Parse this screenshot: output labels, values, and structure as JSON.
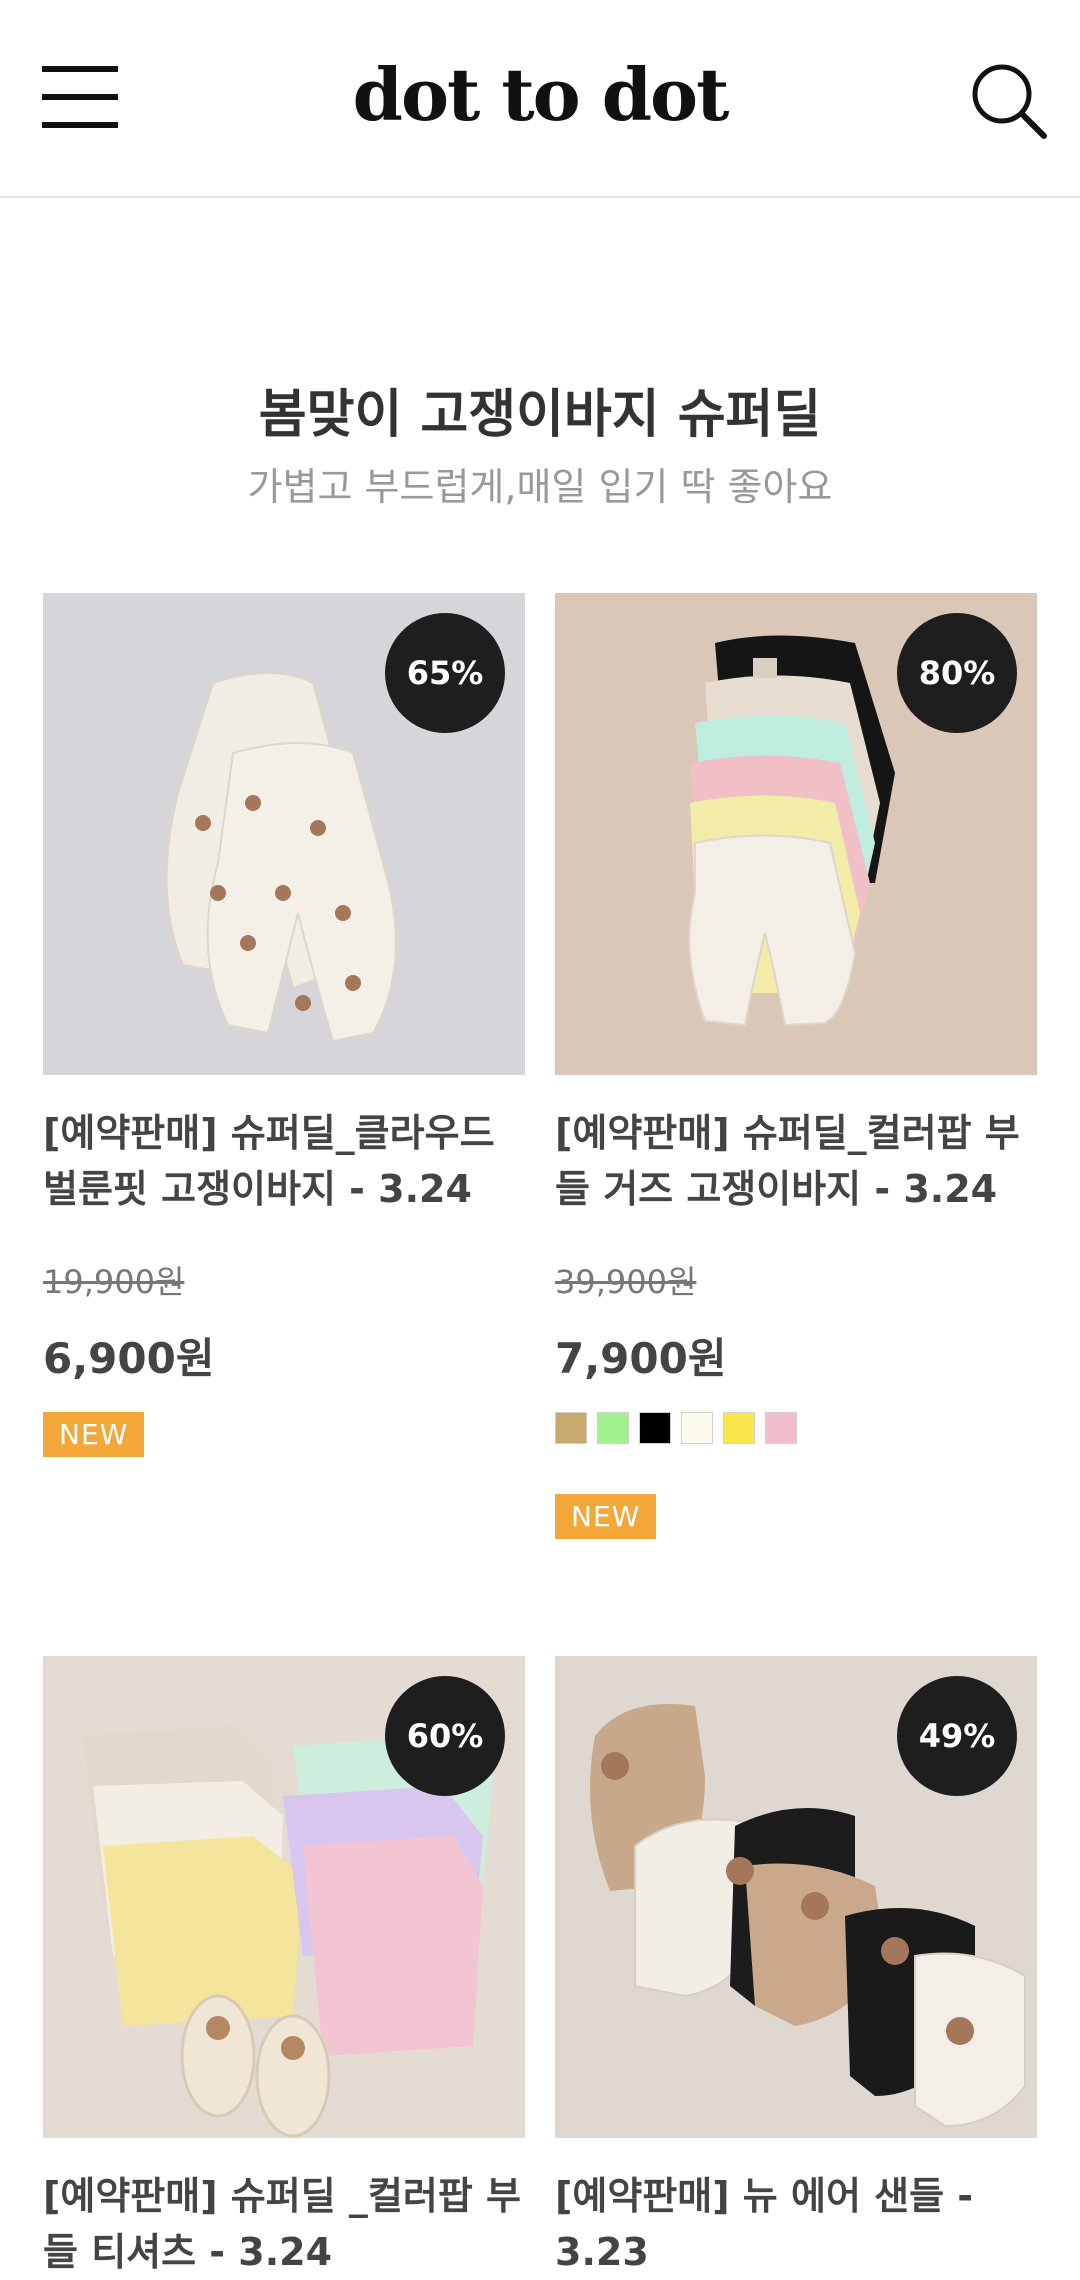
{
  "header": {
    "logo": "dot to dot"
  },
  "section": {
    "title": "봄맞이 고쟁이바지 슈퍼딜",
    "subtitle": "가볍고 부드럽게,매일 입기 딱 좋아요"
  },
  "products": [
    {
      "discount": "65%",
      "name": "[예약판매] 슈퍼딜_클라우드 벌룬핏 고쟁이바지 - 3.24",
      "original_price": "19,900원",
      "price": "6,900원",
      "badge": "NEW",
      "photo_bg": "#d6d5d9"
    },
    {
      "discount": "80%",
      "name": "[예약판매] 슈퍼딜_컬러팝 부들 거즈 고쟁이바지 - 3.24",
      "original_price": "39,900원",
      "price": "7,900원",
      "swatches": [
        "#c9a96e",
        "#a1f28f",
        "#000000",
        "#fdfbee",
        "#f9e74b",
        "#f2bccb"
      ],
      "badge": "NEW",
      "photo_bg": "#dbc7b8"
    },
    {
      "discount": "60%",
      "name": "[예약판매] 슈퍼딜 _컬러팝 부들 티셔츠 - 3.24",
      "photo_bg": "#e4dcd2"
    },
    {
      "discount": "49%",
      "name": "[예약판매] 뉴 에어 샌들 - 3.23",
      "photo_bg": "#dfd8d1"
    }
  ]
}
